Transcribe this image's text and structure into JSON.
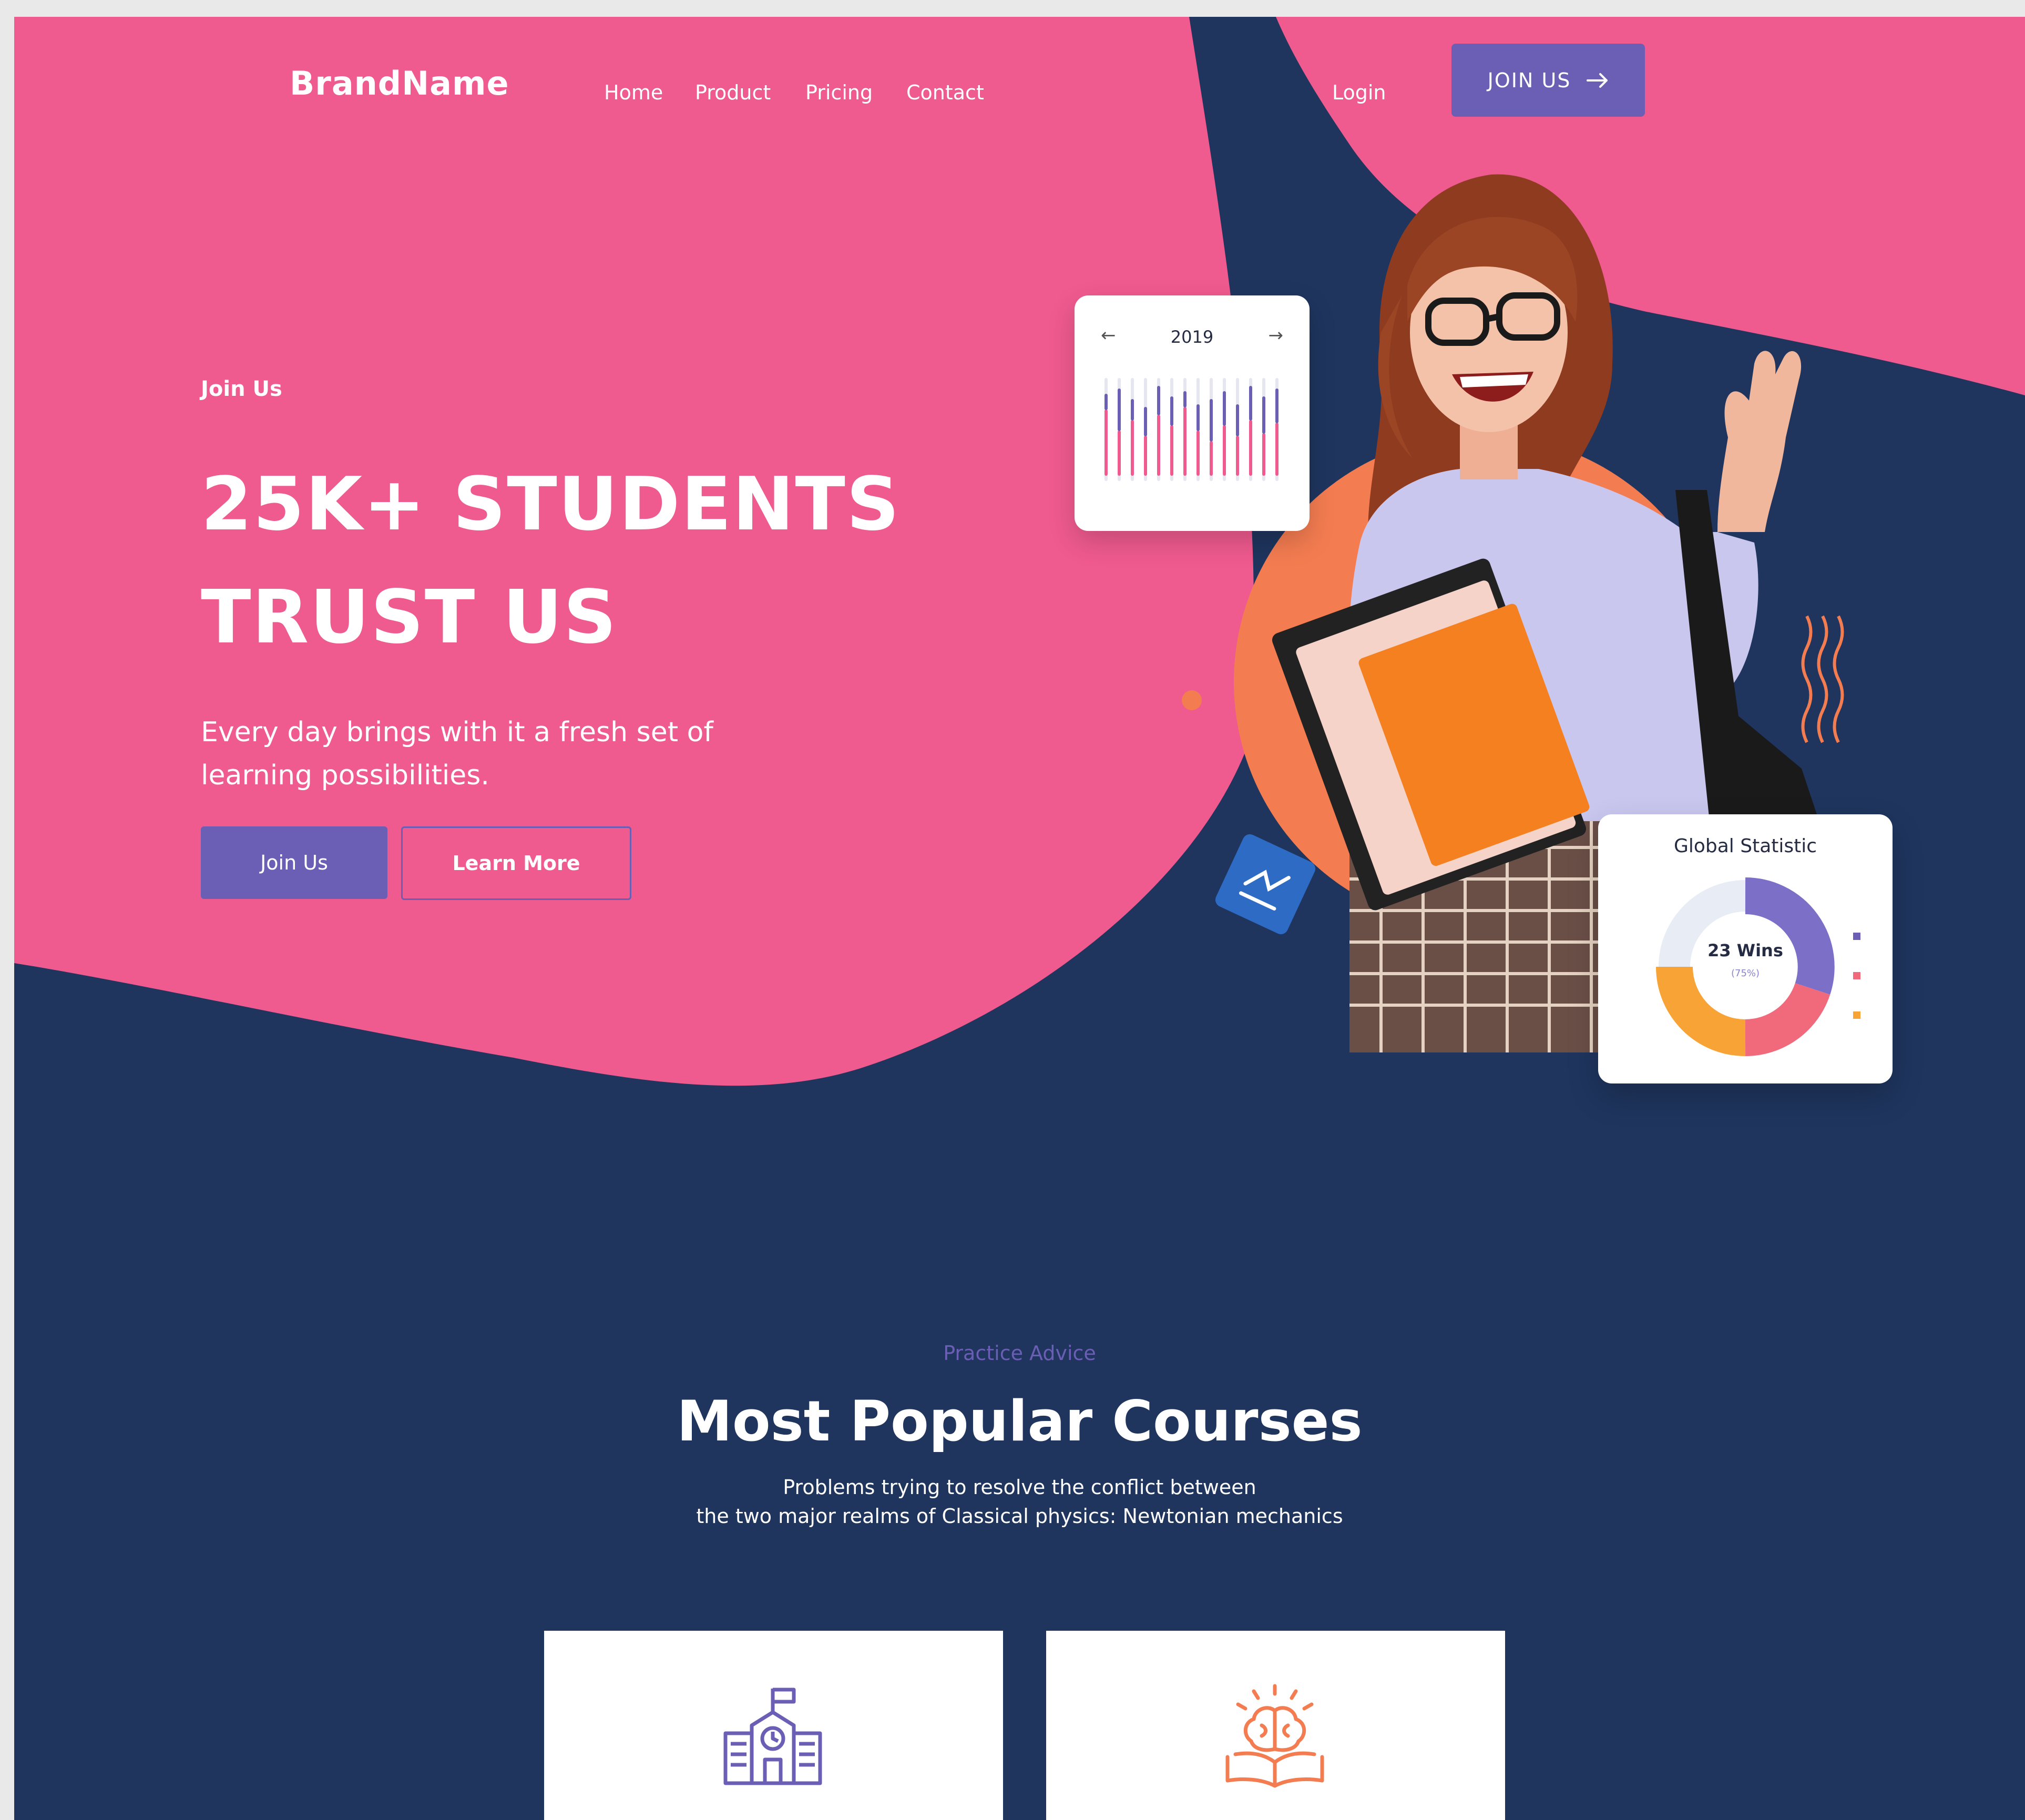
{
  "nav": {
    "brand": "BrandName",
    "links": [
      "Home",
      "Product",
      "Pricing",
      "Contact"
    ],
    "login": "Login",
    "join": "JOIN US",
    "join_icon": "arrow-right-icon"
  },
  "hero": {
    "eyebrow": "Join Us",
    "title_line1": "25K+ STUDENTS",
    "title_line2": "TRUST US",
    "subtitle": "Every day brings with it a fresh set of learning possibilities.",
    "primary_button": "Join Us",
    "secondary_button": "Learn More"
  },
  "calendar_card": {
    "year": "2019",
    "prev_icon": "arrow-left-icon",
    "next_icon": "arrow-right-icon"
  },
  "stat_card": {
    "title": "Global Statistic",
    "center_label": "23 Wins",
    "center_pct": "(75%)",
    "legend_colors": [
      "#6b5fb5",
      "#f06a7c",
      "#f7a335"
    ]
  },
  "section": {
    "eyebrow": "Practice Advice",
    "title": "Most Popular Courses",
    "desc_line1": "Problems trying to resolve the conflict between",
    "desc_line2": "the two major realms of Classical physics: Newtonian mechanics"
  },
  "cards": [
    {
      "icon": "school-building-icon"
    },
    {
      "icon": "brain-book-icon"
    }
  ],
  "colors": {
    "pink": "#ef5a8f",
    "navy": "#1f355e",
    "purple": "#6b5fb5",
    "orange": "#f47c51"
  }
}
